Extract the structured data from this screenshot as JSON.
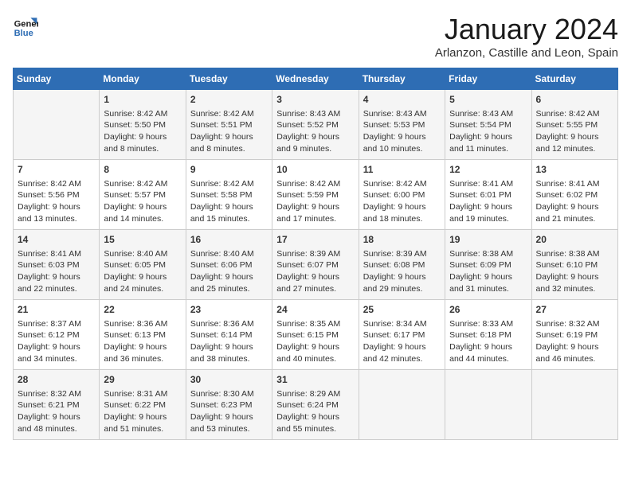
{
  "logo": {
    "line1": "General",
    "line2": "Blue"
  },
  "title": "January 2024",
  "subtitle": "Arlanzon, Castille and Leon, Spain",
  "headers": [
    "Sunday",
    "Monday",
    "Tuesday",
    "Wednesday",
    "Thursday",
    "Friday",
    "Saturday"
  ],
  "weeks": [
    [
      {
        "day": "",
        "info": ""
      },
      {
        "day": "1",
        "info": "Sunrise: 8:42 AM\nSunset: 5:50 PM\nDaylight: 9 hours\nand 8 minutes."
      },
      {
        "day": "2",
        "info": "Sunrise: 8:42 AM\nSunset: 5:51 PM\nDaylight: 9 hours\nand 8 minutes."
      },
      {
        "day": "3",
        "info": "Sunrise: 8:43 AM\nSunset: 5:52 PM\nDaylight: 9 hours\nand 9 minutes."
      },
      {
        "day": "4",
        "info": "Sunrise: 8:43 AM\nSunset: 5:53 PM\nDaylight: 9 hours\nand 10 minutes."
      },
      {
        "day": "5",
        "info": "Sunrise: 8:43 AM\nSunset: 5:54 PM\nDaylight: 9 hours\nand 11 minutes."
      },
      {
        "day": "6",
        "info": "Sunrise: 8:42 AM\nSunset: 5:55 PM\nDaylight: 9 hours\nand 12 minutes."
      }
    ],
    [
      {
        "day": "7",
        "info": "Sunrise: 8:42 AM\nSunset: 5:56 PM\nDaylight: 9 hours\nand 13 minutes."
      },
      {
        "day": "8",
        "info": "Sunrise: 8:42 AM\nSunset: 5:57 PM\nDaylight: 9 hours\nand 14 minutes."
      },
      {
        "day": "9",
        "info": "Sunrise: 8:42 AM\nSunset: 5:58 PM\nDaylight: 9 hours\nand 15 minutes."
      },
      {
        "day": "10",
        "info": "Sunrise: 8:42 AM\nSunset: 5:59 PM\nDaylight: 9 hours\nand 17 minutes."
      },
      {
        "day": "11",
        "info": "Sunrise: 8:42 AM\nSunset: 6:00 PM\nDaylight: 9 hours\nand 18 minutes."
      },
      {
        "day": "12",
        "info": "Sunrise: 8:41 AM\nSunset: 6:01 PM\nDaylight: 9 hours\nand 19 minutes."
      },
      {
        "day": "13",
        "info": "Sunrise: 8:41 AM\nSunset: 6:02 PM\nDaylight: 9 hours\nand 21 minutes."
      }
    ],
    [
      {
        "day": "14",
        "info": "Sunrise: 8:41 AM\nSunset: 6:03 PM\nDaylight: 9 hours\nand 22 minutes."
      },
      {
        "day": "15",
        "info": "Sunrise: 8:40 AM\nSunset: 6:05 PM\nDaylight: 9 hours\nand 24 minutes."
      },
      {
        "day": "16",
        "info": "Sunrise: 8:40 AM\nSunset: 6:06 PM\nDaylight: 9 hours\nand 25 minutes."
      },
      {
        "day": "17",
        "info": "Sunrise: 8:39 AM\nSunset: 6:07 PM\nDaylight: 9 hours\nand 27 minutes."
      },
      {
        "day": "18",
        "info": "Sunrise: 8:39 AM\nSunset: 6:08 PM\nDaylight: 9 hours\nand 29 minutes."
      },
      {
        "day": "19",
        "info": "Sunrise: 8:38 AM\nSunset: 6:09 PM\nDaylight: 9 hours\nand 31 minutes."
      },
      {
        "day": "20",
        "info": "Sunrise: 8:38 AM\nSunset: 6:10 PM\nDaylight: 9 hours\nand 32 minutes."
      }
    ],
    [
      {
        "day": "21",
        "info": "Sunrise: 8:37 AM\nSunset: 6:12 PM\nDaylight: 9 hours\nand 34 minutes."
      },
      {
        "day": "22",
        "info": "Sunrise: 8:36 AM\nSunset: 6:13 PM\nDaylight: 9 hours\nand 36 minutes."
      },
      {
        "day": "23",
        "info": "Sunrise: 8:36 AM\nSunset: 6:14 PM\nDaylight: 9 hours\nand 38 minutes."
      },
      {
        "day": "24",
        "info": "Sunrise: 8:35 AM\nSunset: 6:15 PM\nDaylight: 9 hours\nand 40 minutes."
      },
      {
        "day": "25",
        "info": "Sunrise: 8:34 AM\nSunset: 6:17 PM\nDaylight: 9 hours\nand 42 minutes."
      },
      {
        "day": "26",
        "info": "Sunrise: 8:33 AM\nSunset: 6:18 PM\nDaylight: 9 hours\nand 44 minutes."
      },
      {
        "day": "27",
        "info": "Sunrise: 8:32 AM\nSunset: 6:19 PM\nDaylight: 9 hours\nand 46 minutes."
      }
    ],
    [
      {
        "day": "28",
        "info": "Sunrise: 8:32 AM\nSunset: 6:21 PM\nDaylight: 9 hours\nand 48 minutes."
      },
      {
        "day": "29",
        "info": "Sunrise: 8:31 AM\nSunset: 6:22 PM\nDaylight: 9 hours\nand 51 minutes."
      },
      {
        "day": "30",
        "info": "Sunrise: 8:30 AM\nSunset: 6:23 PM\nDaylight: 9 hours\nand 53 minutes."
      },
      {
        "day": "31",
        "info": "Sunrise: 8:29 AM\nSunset: 6:24 PM\nDaylight: 9 hours\nand 55 minutes."
      },
      {
        "day": "",
        "info": ""
      },
      {
        "day": "",
        "info": ""
      },
      {
        "day": "",
        "info": ""
      }
    ]
  ]
}
